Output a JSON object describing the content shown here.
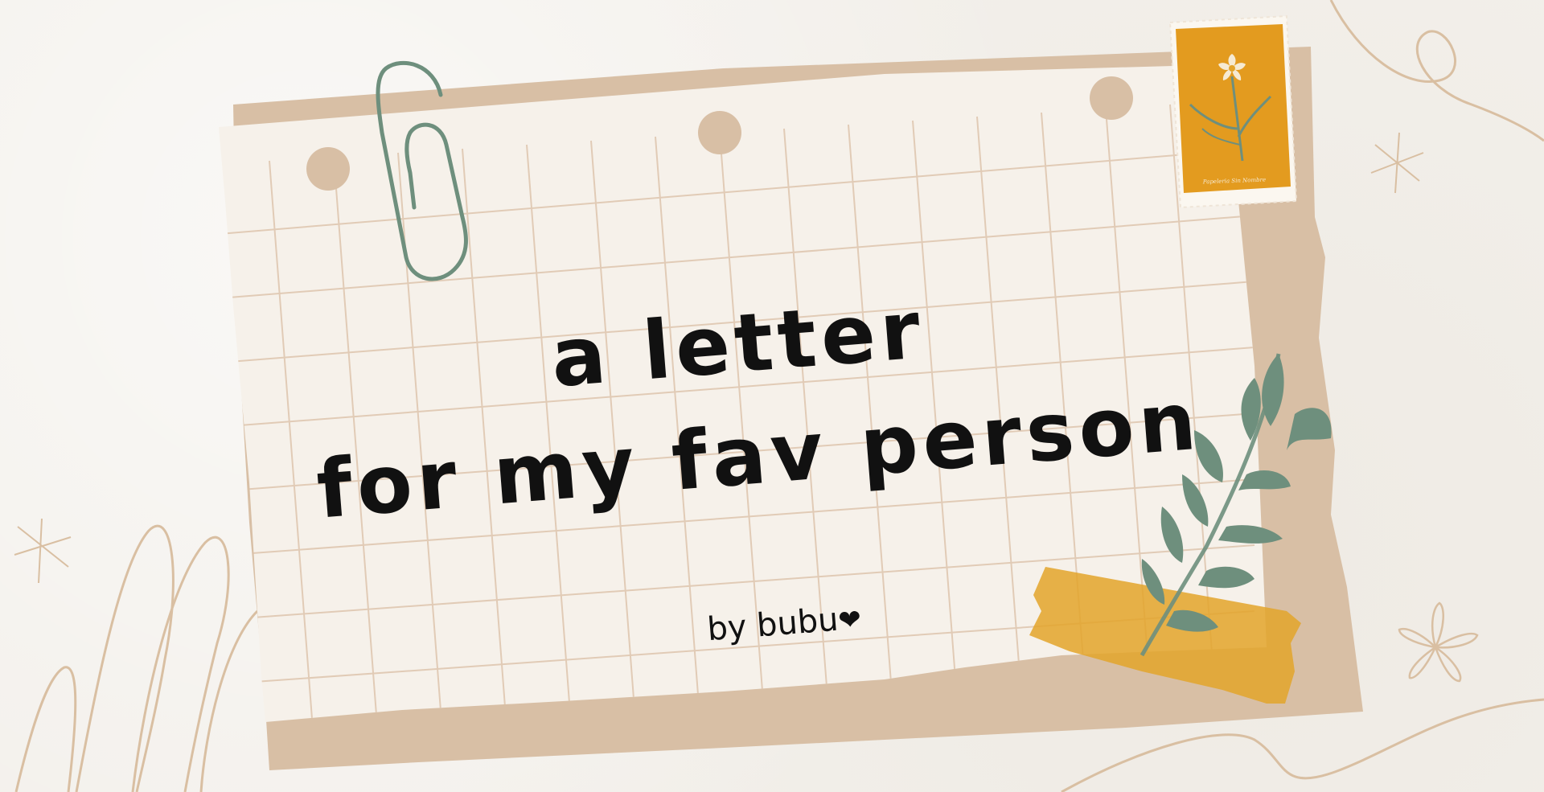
{
  "card": {
    "title_line_1": "a letter",
    "title_line_2": "for my fav person",
    "byline": "by bubu",
    "byline_heart": "❤"
  },
  "stamp": {
    "caption": "Papeleria Sin Nombre"
  },
  "icons": {
    "paperclip": "paperclip-icon",
    "stamp": "postage-stamp-icon",
    "leaf_sprig": "leaf-sprig-icon",
    "tape": "masking-tape-icon",
    "sparkles": [
      "sparkle-icon",
      "flower-doodle-icon"
    ]
  },
  "colors": {
    "background": "#f3f0eb",
    "paper": "#f6f1ea",
    "paper_back": "#d8bfa5",
    "grid_lines": "#e1cbb6",
    "hole": "#d8bfa5",
    "paperclip": "#6e8f7d",
    "stamp": "#e39b1f",
    "leaf": "#6e8f7d",
    "tape": "#e3a42a",
    "doodle": "#d9bfa2",
    "text": "#111111"
  }
}
